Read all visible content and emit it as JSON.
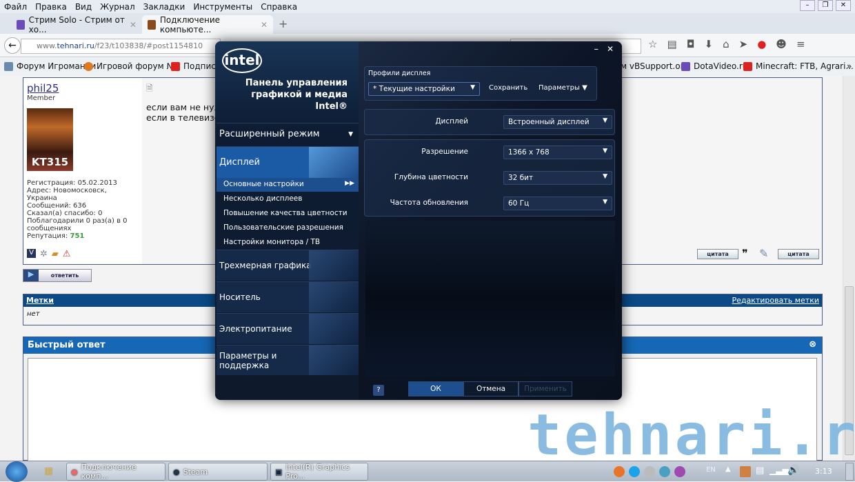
{
  "menu": [
    "Файл",
    "Правка",
    "Вид",
    "Журнал",
    "Закладки",
    "Инструменты",
    "Справка"
  ],
  "tabs": [
    {
      "label": "Стрим Solo - Стрим от хо...",
      "fav_color": "#6a4bb8"
    },
    {
      "label": "Подключение компьюте...",
      "fav_color": "#8a4a1a"
    }
  ],
  "address": {
    "prefix": "www.",
    "domain": "tehnari.ru",
    "path": "/f23/t103838/#post1154810"
  },
  "bookmarks": [
    {
      "label": "Форум Игромании",
      "color": "#6a8ab0"
    },
    {
      "label": "Игровой форум №1",
      "color": "#e07a20"
    },
    {
      "label": "Подписк",
      "color": "#d22"
    },
    {
      "label": "м vBSupport.org",
      "color": ""
    },
    {
      "label": "DotaVideo.ru",
      "color": "#6a4bb8"
    },
    {
      "label": "Minecraft: FTB, Agrari...",
      "color": "#d22"
    }
  ],
  "bookmarks_more": "»",
  "post": {
    "username": "phil25",
    "role": "Member",
    "avatar_text": "KT315",
    "info": [
      "Регистрация: 05.02.2013",
      "Адрес: Новомосковск,",
      "Украина",
      "Сообщений: 636",
      "Сказал(а) спасибо: 0",
      "Поблагодарили 0 раз(а) в 0",
      "сообщениях"
    ],
    "reputation_label": "Репутация:",
    "reputation": "751",
    "text_line1": "если вам не нужно ... то будет отображаться на телевизоре, а",
    "text_line2": "если в телевизо ... нитора",
    "quote_label": "цитата",
    "multiquote_label": "цитата"
  },
  "reply_label": "ответить",
  "tags": {
    "title": "Метки",
    "edit": "Редактировать метки",
    "value": "нет"
  },
  "quick_reply": {
    "title": "Быстрый ответ"
  },
  "intel": {
    "logo": "intel",
    "title_lines": [
      "Панель управления",
      "графикой и медиа",
      "Intel®"
    ],
    "mode": "Расширенный режим",
    "categories": [
      {
        "label": "Дисплей"
      },
      {
        "label": "Трехмерная графика"
      },
      {
        "label": "Носитель"
      },
      {
        "label": "Электропитание"
      },
      {
        "label": "Параметры и поддержка"
      }
    ],
    "subitems": [
      "Основные настройки",
      "Несколько дисплеев",
      "Повышение качества цветности",
      "Пользовательские разрешения",
      "Настройки монитора / ТВ"
    ],
    "profiles_label": "Профили дисплея",
    "profile_value": "* Текущие настройки",
    "save": "Сохранить",
    "params": "Параметры",
    "settings": [
      {
        "label": "Дисплей",
        "value": "Встроенный дисплей"
      },
      {
        "label": "Разрешение",
        "value": "1366 x 768"
      },
      {
        "label": "Глубина цветности",
        "value": "32 бит"
      },
      {
        "label": "Частота обновления",
        "value": "60 Гц"
      }
    ],
    "help": "?",
    "ok": "ОК",
    "cancel": "Отмена",
    "apply": "Применить"
  },
  "taskbar": {
    "items": [
      "Подключение комп...",
      "Steam",
      "Intel(R) Graphics Pro..."
    ],
    "lang": "EN",
    "clock": "3:13"
  },
  "watermark": "tehnari.ru"
}
